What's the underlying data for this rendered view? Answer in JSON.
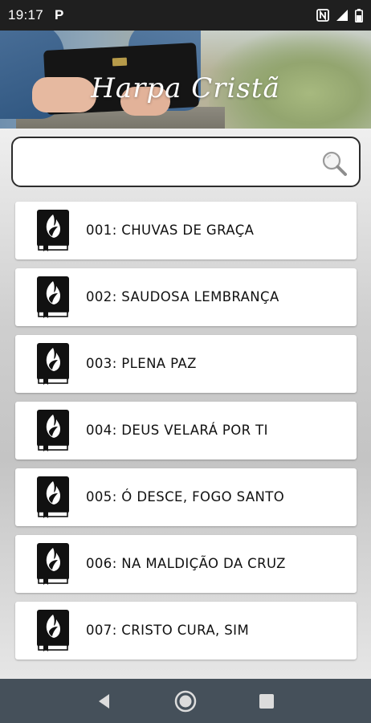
{
  "status_bar": {
    "time": "19:17",
    "notification_letter": "P"
  },
  "header": {
    "title": "Harpa Cristã"
  },
  "search": {
    "value": "",
    "placeholder": ""
  },
  "hymns": [
    {
      "label": "001: CHUVAS DE GRAÇA"
    },
    {
      "label": "002: SAUDOSA LEMBRANÇA"
    },
    {
      "label": "003: PLENA PAZ"
    },
    {
      "label": "004: DEUS VELARÁ POR TI"
    },
    {
      "label": "005: Ó DESCE, FOGO SANTO"
    },
    {
      "label": "006: NA MALDIÇÃO DA CRUZ"
    },
    {
      "label": "007: CRISTO CURA, SIM"
    }
  ],
  "icons": {
    "list_item": "hymn-book-icon",
    "search": "search-icon",
    "nav_back": "back-icon",
    "nav_home": "home-icon",
    "nav_recents": "recents-icon"
  },
  "colors": {
    "status_bar": "#1f1f1f",
    "nav_bar": "#45505a",
    "list_item_bg": "#ffffff",
    "text": "#111111"
  }
}
